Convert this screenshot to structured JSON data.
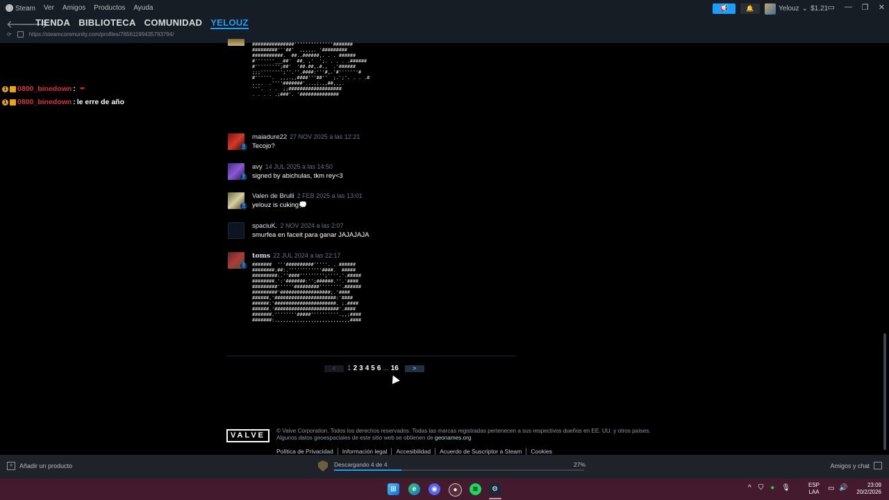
{
  "titlebar": {
    "menu": [
      "Steam",
      "Ver",
      "Amigos",
      "Productos",
      "Ayuda"
    ],
    "user_name": "Yelouz",
    "balance": "$1.21"
  },
  "navbar": {
    "tabs": [
      "TIENDA",
      "BIBLIOTECA",
      "COMUNIDAD",
      "YELOUZ"
    ],
    "url": "https://steamcommunity.com/profiles/76561199435793794/"
  },
  "chat_overlay": [
    {
      "user": "0800_binedown",
      "sep": " :",
      "message": ""
    },
    {
      "user": "0800_binedown",
      "sep": " :",
      "message": " le erre de año"
    }
  ],
  "ascii_art_top": "###############''''''''''''''#######\n#########'''##'  ,,,,,. '#########\n###########.  ##..######,. . . ######\n#'''''''___##'  ##. ,'  ';. . . . .######\n#''''''''';##'  '##.##,.#.,  .'######\n;;;'''''''';''.''.####:'''#,.'#'''''''#\n#''''''.  ,,,.,,####'''##''  ;.';'. . . .#\n,.,.  .''''#######'...,;.,,##,.,.\n'''.  . .  ;;###################\n. . . . .;###'. '##############",
  "comments": [
    {
      "author": "maiadure22",
      "date": "27 NOV 2025 a las 12:21",
      "text": "Tecojo?"
    },
    {
      "author": "avy",
      "date": "14 JUL 2025 a las 14:50",
      "text": "signed by abichulas, tkm rey<3"
    },
    {
      "author": "Valen de Brulli",
      "date": "2 FEB 2025 a las 13:01",
      "text": "yelouz is cuking"
    },
    {
      "author": "spaciuK.",
      "date": "2 NOV 2024 a las 2:07",
      "text": "smurfea en faceit para ganar JAJAJAJA"
    },
    {
      "author": "toms",
      "date": "22 JUL 2024 a las 22:17",
      "text": ""
    }
  ],
  "ascii_art_bottom": "#######  '''##########'''''. . ######\n########.##:.''''''''''''####.  #####\n#########:.''####''''''''';''''.'.#####\n########.':'#######:'';######.''.'####\n#########''''''#########''''''''.######\n#########'##################;.'####\n######,'######################:'####\n######:'######################. ;.####\n######.'#######################'.####\n#######.''''''''#####''''''''''.,,;####\n#######:.,,,,,,,,,,,,,,,,,,,,,,,,,,####",
  "pagination": {
    "prev": "<",
    "pages": [
      "1",
      "2",
      "3",
      "4",
      "5",
      "6"
    ],
    "current": "1",
    "dots": "...",
    "last": "16",
    "next": ">"
  },
  "footer": {
    "logo": "VALVE",
    "copyright_1": "© Valve Corporation. Todos los derechos reservados. Todas las marcas registradas pertenecen a sus respectivos dueños en EE. UU. y otros países.",
    "copyright_2": "Algunos datos geoespaciales de este sitio web se obtienen de ",
    "geonames": "geonames.org",
    "links": [
      "Política de Privacidad",
      "Información legal",
      "Accesibilidad",
      "Acuerdo de Suscriptor a Steam",
      "Cookies"
    ]
  },
  "statusbar": {
    "add_product": "Añadir un producto",
    "download_text": "Descargando 4 de 4",
    "download_percent": "27%",
    "download_progress": 0.27,
    "friends_chat": "Amigos y chat"
  },
  "taskbar": {
    "lang_1": "ESP",
    "lang_2": "LAA",
    "time": "23:09",
    "date": "20/2/2026"
  },
  "colors": {
    "accent": "#1a9fff",
    "chat_username": "#d6323a",
    "taskbar": "#431a2e"
  }
}
